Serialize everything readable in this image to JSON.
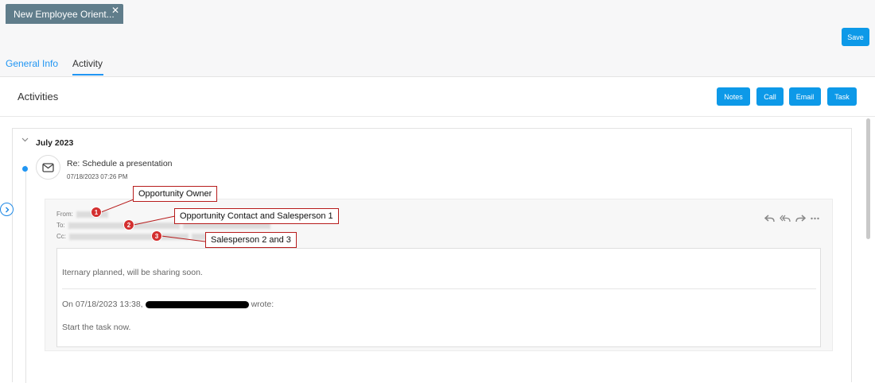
{
  "doc_tab": {
    "title": "New Employee Orient...",
    "close_glyph": "✕"
  },
  "toolbar": {
    "save_label": "Save"
  },
  "tabs": [
    {
      "label": "General Info"
    },
    {
      "label": "Activity"
    }
  ],
  "activities": {
    "title": "Activities",
    "buttons": {
      "notes": "Notes",
      "call": "Call",
      "email": "Email",
      "task": "Task"
    },
    "month": "July 2023",
    "item": {
      "subject": "Re: Schedule a presentation",
      "timestamp": "07/18/2023 07:26 PM",
      "from_label": "From:",
      "to_label": "To:",
      "cc_label": "Cc:",
      "body_text": "Iternary planned, will be sharing soon.",
      "quote_prefix": "On 07/18/2023 13:38,",
      "quote_suffix": "wrote:",
      "quoted_text": "Start the task now."
    }
  },
  "annotations": [
    {
      "number": "1",
      "label": "Opportunity Owner"
    },
    {
      "number": "2",
      "label": "Opportunity Contact and Salesperson 1"
    },
    {
      "number": "3",
      "label": "Salesperson 2 and 3"
    }
  ],
  "colors": {
    "accent": "#0d99e8",
    "tab_bg": "#607d8b",
    "callout_border": "#b71c1c",
    "badge": "#d32f2f"
  }
}
